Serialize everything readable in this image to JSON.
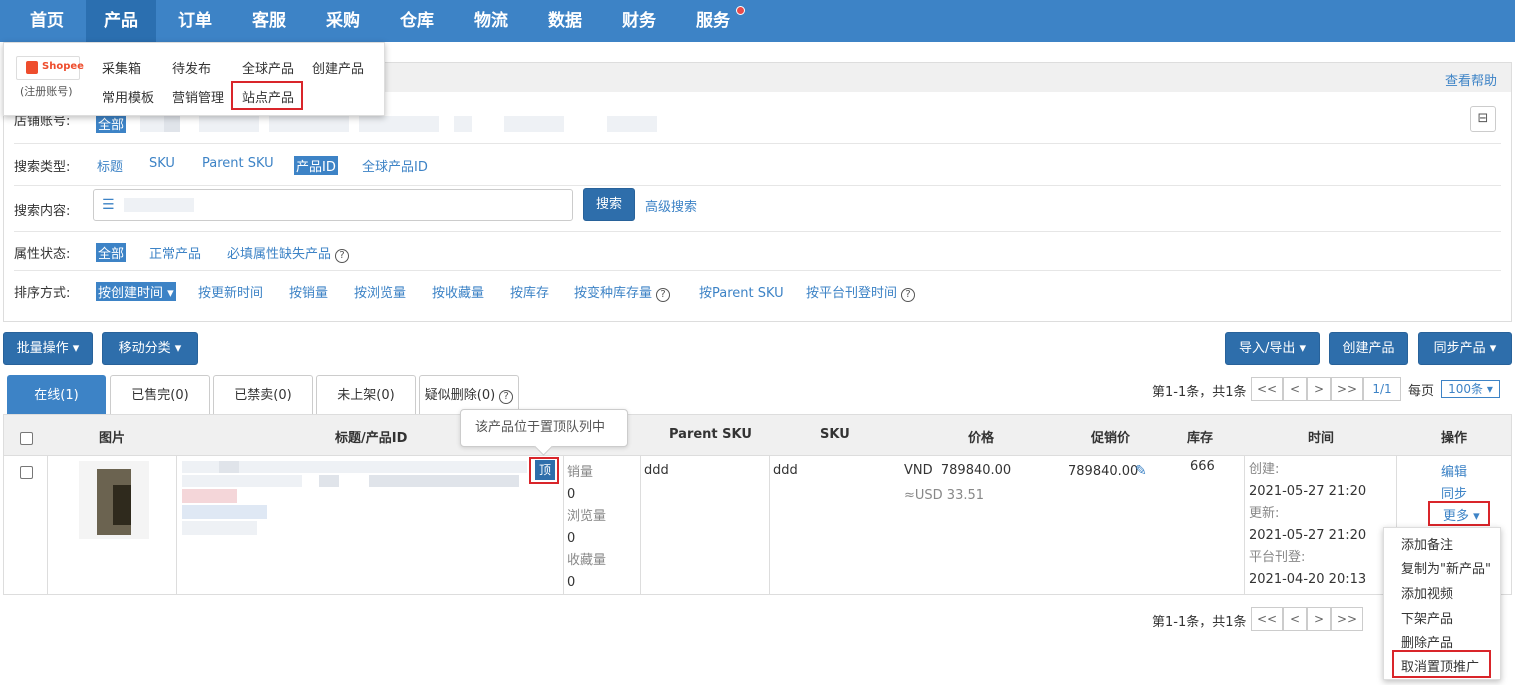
{
  "nav": {
    "items": [
      "首页",
      "产品",
      "订单",
      "客服",
      "采购",
      "仓库",
      "物流",
      "数据",
      "财务",
      "服务"
    ],
    "active": "产品"
  },
  "product_menu": {
    "platform_logo": "Shopee",
    "platform_sub": "(注册账号)",
    "items": [
      "采集箱",
      "待发布",
      "全球产品",
      "创建产品",
      "常用模板",
      "营销管理",
      "站点产品"
    ],
    "highlighted": "站点产品"
  },
  "help_link": "查看帮助",
  "filters": {
    "store_label": "店铺账号:",
    "store_all": "全部",
    "search_type_label": "搜索类型:",
    "search_types": [
      "标题",
      "SKU",
      "Parent SKU",
      "产品ID",
      "全球产品ID"
    ],
    "search_type_selected": "产品ID",
    "search_content_label": "搜索内容:",
    "search_button": "搜索",
    "advanced_search": "高级搜索",
    "attr_label": "属性状态:",
    "attr_options": [
      "全部",
      "正常产品",
      "必填属性缺失产品"
    ],
    "sort_label": "排序方式:",
    "sort_options": [
      "按创建时间",
      "按更新时间",
      "按销量",
      "按浏览量",
      "按收藏量",
      "按库存",
      "按变种库存量",
      "按Parent SKU",
      "按平台刊登时间"
    ]
  },
  "toolbar": {
    "batch": "批量操作",
    "move_category": "移动分类",
    "import_export": "导入/导出",
    "create_product": "创建产品",
    "sync_product": "同步产品"
  },
  "tabs": [
    "在线(1)",
    "已售完(0)",
    "已禁卖(0)",
    "未上架(0)",
    "疑似删除(0)"
  ],
  "pager": {
    "summary": "第1-1条，共1条",
    "first": "<<",
    "prev": "<",
    "next": ">",
    "last": ">>",
    "page": "1/1",
    "per_page_label": "每页",
    "per_page_value": "100条"
  },
  "table": {
    "headers": [
      "图片",
      "标题/产品ID",
      "Parent SKU",
      "SKU",
      "价格",
      "促销价",
      "库存",
      "时间",
      "操作"
    ],
    "row": {
      "top_badge": "顶",
      "stats": [
        "销量",
        "0",
        "浏览量",
        "0",
        "收藏量",
        "0"
      ],
      "parent_sku": "ddd",
      "sku": "ddd",
      "price": "VND  789840.00",
      "price_usd": "≈USD 33.51",
      "promo_price": "789840.00",
      "stock": "666",
      "time_created_label": "创建:",
      "time_created": "2021-05-27 21:20",
      "time_updated_label": "更新:",
      "time_updated": "2021-05-27 21:20",
      "time_listed_label": "平台刊登:",
      "time_listed": "2021-04-20 20:13",
      "actions": [
        "编辑",
        "同步",
        "更多"
      ]
    }
  },
  "tooltip": "该产品位于置顶队列中",
  "more_menu": [
    "添加备注",
    "复制为\"新产品\"",
    "添加视频",
    "下架产品",
    "删除产品",
    "取消置顶推广"
  ]
}
